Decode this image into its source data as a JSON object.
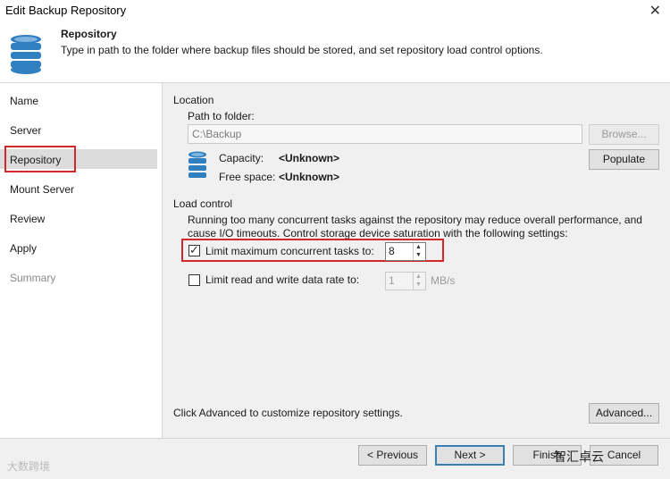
{
  "window": {
    "title": "Edit Backup Repository",
    "close_glyph": "✕"
  },
  "header": {
    "title": "Repository",
    "description": "Type in path to the folder where backup files should be stored, and set repository load control options."
  },
  "sidebar": {
    "items": [
      {
        "label": "Name"
      },
      {
        "label": "Server"
      },
      {
        "label": "Repository"
      },
      {
        "label": "Mount Server"
      },
      {
        "label": "Review"
      },
      {
        "label": "Apply"
      },
      {
        "label": "Summary"
      }
    ]
  },
  "location": {
    "section_title": "Location",
    "path_label": "Path to folder:",
    "path_value": "C:\\Backup",
    "browse_label": "Browse...",
    "capacity_label": "Capacity:",
    "capacity_value": "<Unknown>",
    "free_label": "Free space:",
    "free_value": "<Unknown>",
    "populate_label": "Populate"
  },
  "load_control": {
    "section_title": "Load control",
    "description_line1": "Running too many concurrent tasks against the repository may reduce overall performance, and",
    "description_line2": "cause I/O timeouts. Control storage device saturation with the following settings:",
    "limit_tasks_label": "Limit maximum concurrent tasks to:",
    "limit_tasks_checked": true,
    "limit_tasks_value": "8",
    "limit_rate_label": "Limit read and write data rate to:",
    "limit_rate_checked": false,
    "limit_rate_value": "1",
    "limit_rate_unit": "MB/s"
  },
  "advanced": {
    "hint": "Click Advanced to customize repository settings.",
    "button_label": "Advanced..."
  },
  "footer": {
    "previous_label": "< Previous",
    "next_label": "Next >",
    "finish_label": "Finish",
    "cancel_label": "Cancel",
    "watermark_left": "大数跨境",
    "watermark_right": "智汇卓云"
  },
  "colors": {
    "highlight_red": "#d22828",
    "db_icon_blue": "#2f7fc1",
    "content_bg": "#f0f0f0"
  },
  "icons": [
    "database-icon",
    "close-icon",
    "checkbox-checked-icon",
    "spin-up-icon",
    "spin-down-icon"
  ]
}
